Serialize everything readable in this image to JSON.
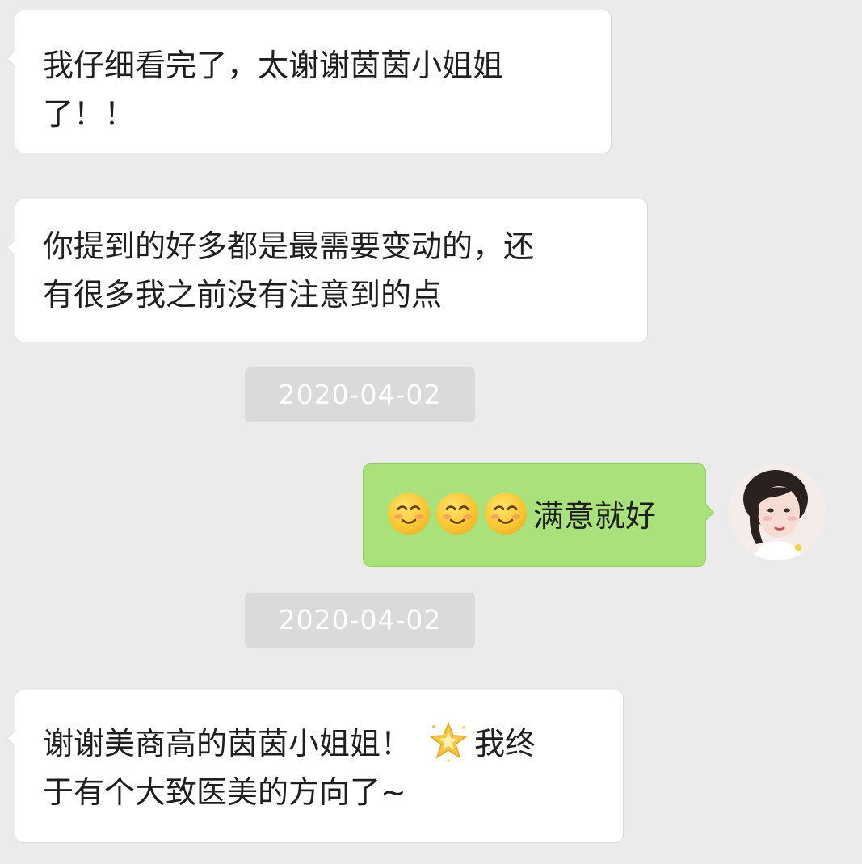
{
  "messages": [
    {
      "direction": "incoming",
      "lines": [
        "我仔细看完了，太谢谢茵茵小姐姐",
        "了！！"
      ]
    },
    {
      "direction": "incoming",
      "lines": [
        "你提到的好多都是最需要变动的，还",
        "有很多我之前没有注意到的点"
      ]
    },
    {
      "direction": "timestamp",
      "text": "2020-04-02"
    },
    {
      "direction": "outgoing",
      "emoji": [
        "relieved-face",
        "relieved-face",
        "relieved-face"
      ],
      "text": "满意就好"
    },
    {
      "direction": "timestamp",
      "text": "2020-04-02"
    },
    {
      "direction": "incoming",
      "line1_before": "谢谢美商高的茵茵小姐姐！",
      "line1_emoji": "glowing-star",
      "line1_after": "我终",
      "line2": "于有个大致医美的方向了~"
    }
  ],
  "colors": {
    "background": "#ebebeb",
    "incoming_bubble": "#ffffff",
    "outgoing_bubble": "#a9e27a",
    "timestamp_bg": "#dadada",
    "timestamp_text": "#ffffff",
    "text": "#1f1f1f"
  }
}
